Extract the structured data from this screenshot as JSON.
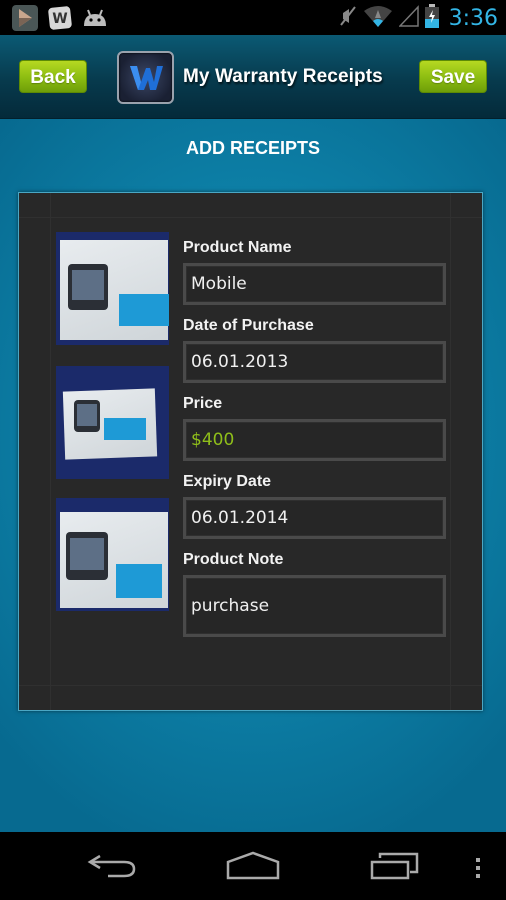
{
  "status_bar": {
    "notification_icons": [
      "play-store-icon",
      "word-app-icon",
      "android-debug-icon"
    ],
    "system_icons": [
      "vibrate-mute-icon",
      "wifi-icon",
      "signal-icon",
      "battery-charging-icon"
    ],
    "time": "3:36",
    "accent_color": "#33b5e5"
  },
  "header": {
    "back_label": "Back",
    "app_title": "My Warranty Receipts",
    "save_label": "Save",
    "logo_letter": "W",
    "button_color": "#8fbf12"
  },
  "page": {
    "section_title": "ADD RECEIPTS"
  },
  "receipt_images": [
    {
      "alt": "Samsung Galaxy Ace box photo 1"
    },
    {
      "alt": "Samsung Galaxy Ace box photo 2"
    },
    {
      "alt": "Samsung Galaxy Ace box photo 3"
    }
  ],
  "form": {
    "fields": [
      {
        "label": "Product Name",
        "value": "Mobile"
      },
      {
        "label": "Date of Purchase",
        "value": "06.01.2013"
      },
      {
        "label": "Price",
        "value": "$400"
      },
      {
        "label": "Expiry Date",
        "value": "06.01.2014"
      },
      {
        "label": "Product Note",
        "value": "purchase"
      }
    ],
    "price_color": "#8fbe1a"
  },
  "nav_bar": {
    "buttons": [
      "back",
      "home",
      "recent-apps",
      "menu"
    ]
  }
}
